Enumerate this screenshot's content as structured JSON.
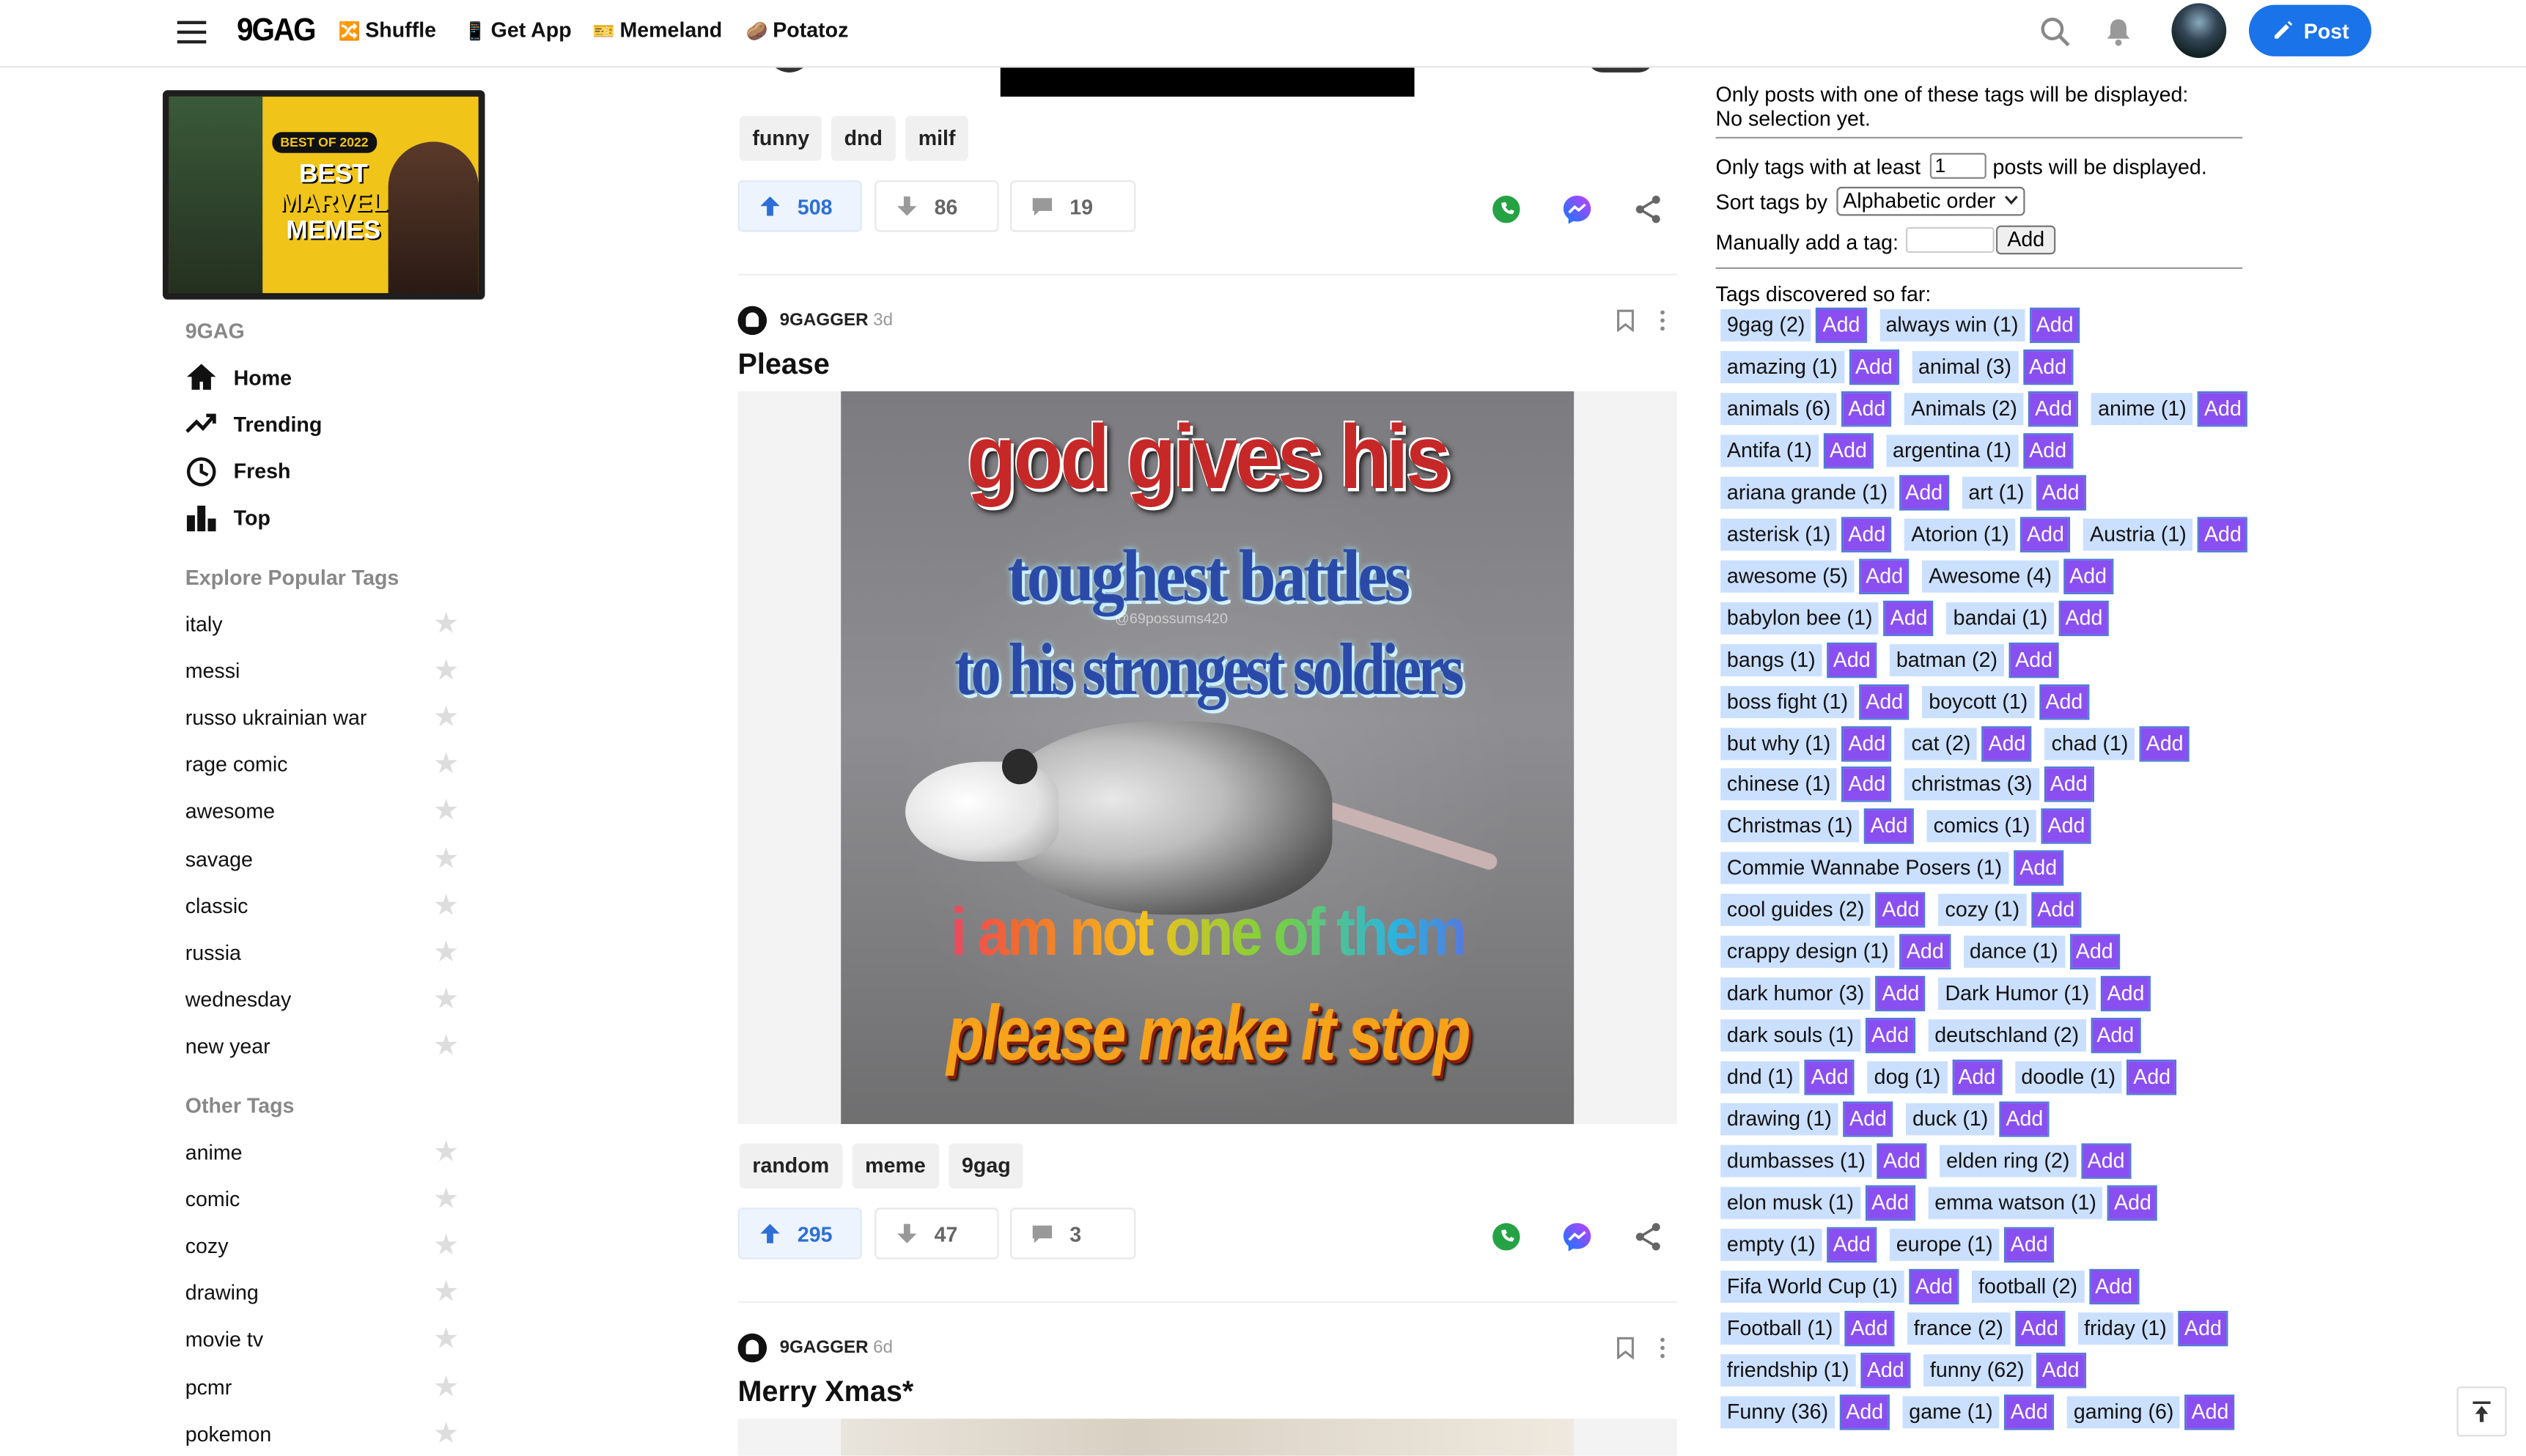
{
  "header": {
    "logo": "9GAG",
    "nav": [
      {
        "icon": "shuffle-icon",
        "label": "Shuffle"
      },
      {
        "icon": "phone-icon",
        "label": "Get App"
      },
      {
        "icon": "memeland-icon",
        "label": "Memeland"
      },
      {
        "icon": "potato-icon",
        "label": "Potatoz"
      }
    ],
    "post_label": "Post",
    "colors": {
      "accent": "#1a73e8"
    }
  },
  "sidebar": {
    "banner": {
      "badge": "BEST OF 2022",
      "line1": "BEST",
      "line2": "MARVEL",
      "line3": "MEMES"
    },
    "section_title": "9GAG",
    "menu": [
      {
        "icon": "home-icon",
        "label": "Home"
      },
      {
        "icon": "trending-icon",
        "label": "Trending"
      },
      {
        "icon": "clock-icon",
        "label": "Fresh"
      },
      {
        "icon": "bar-chart-icon",
        "label": "Top"
      }
    ],
    "popular_title": "Explore Popular Tags",
    "popular_tags": [
      "italy",
      "messi",
      "russo ukrainian war",
      "rage comic",
      "awesome",
      "savage",
      "classic",
      "russia",
      "wednesday",
      "new year"
    ],
    "other_title": "Other Tags",
    "other_tags": [
      "anime",
      "comic",
      "cozy",
      "drawing",
      "movie tv",
      "pcmr",
      "pokemon"
    ]
  },
  "feed": {
    "prev_post": {
      "tags": [
        "funny",
        "dnd",
        "milf"
      ],
      "upvotes": "508",
      "downvotes": "86",
      "comments": "19"
    },
    "post": {
      "author": "9GAGGER",
      "time": "3d",
      "title": "Please",
      "meme_text": {
        "line1": "god gives his",
        "line2": "toughest battles",
        "line3": "to his strongest soldiers",
        "line4": "i am not one of them",
        "line5": "please make it stop",
        "watermark": "@69possums420"
      },
      "tags": [
        "random",
        "meme",
        "9gag"
      ],
      "upvotes": "295",
      "downvotes": "47",
      "comments": "3"
    },
    "next_post": {
      "author": "9GAGGER",
      "time": "6d",
      "title": "Merry Xmas*"
    }
  },
  "tag_panel": {
    "info_line1": "Only posts with one of these tags will be displayed:",
    "info_line2": "No selection yet.",
    "min_label_pre": "Only tags with at least",
    "min_value": "1",
    "min_label_post": "posts will be displayed.",
    "sort_label": "Sort tags by",
    "sort_value": "Alphabetic order",
    "manual_label": "Manually add a tag:",
    "add_label": "Add",
    "discovered_label": "Tags discovered so far:",
    "rows": [
      [
        "9gag (2)",
        "always win (1)"
      ],
      [
        "amazing (1)",
        "animal (3)"
      ],
      [
        "animals (6)",
        "Animals (2)",
        "anime (1)"
      ],
      [
        "Antifa (1)",
        "argentina (1)"
      ],
      [
        "ariana grande (1)",
        "art (1)"
      ],
      [
        "asterisk (1)",
        "Atorion (1)",
        "Austria (1)"
      ],
      [
        "awesome (5)",
        "Awesome (4)"
      ],
      [
        "babylon bee (1)",
        "bandai (1)"
      ],
      [
        "bangs (1)",
        "batman (2)"
      ],
      [
        "boss fight (1)",
        "boycott (1)"
      ],
      [
        "but why (1)",
        "cat (2)",
        "chad (1)"
      ],
      [
        "chinese (1)",
        "christmas (3)"
      ],
      [
        "Christmas (1)",
        "comics (1)"
      ],
      [
        "Commie Wannabe Posers (1)"
      ],
      [
        "cool guides (2)",
        "cozy (1)"
      ],
      [
        "crappy design (1)",
        "dance (1)"
      ],
      [
        "dark humor (3)",
        "Dark Humor (1)"
      ],
      [
        "dark souls (1)",
        "deutschland (2)"
      ],
      [
        "dnd (1)",
        "dog (1)",
        "doodle (1)"
      ],
      [
        "drawing (1)",
        "duck (1)"
      ],
      [
        "dumbasses (1)",
        "elden ring (2)"
      ],
      [
        "elon musk (1)",
        "emma watson (1)"
      ],
      [
        "empty (1)",
        "europe (1)"
      ],
      [
        "Fifa World Cup (1)",
        "football (2)"
      ],
      [
        "Football (1)",
        "france (2)",
        "friday (1)"
      ],
      [
        "friendship (1)",
        "funny (62)"
      ],
      [
        "Funny (36)",
        "game (1)",
        "gaming (6)"
      ]
    ],
    "colors": {
      "tag_bg": "#cbe0ff",
      "add_bg": "#8a4ff0"
    }
  }
}
